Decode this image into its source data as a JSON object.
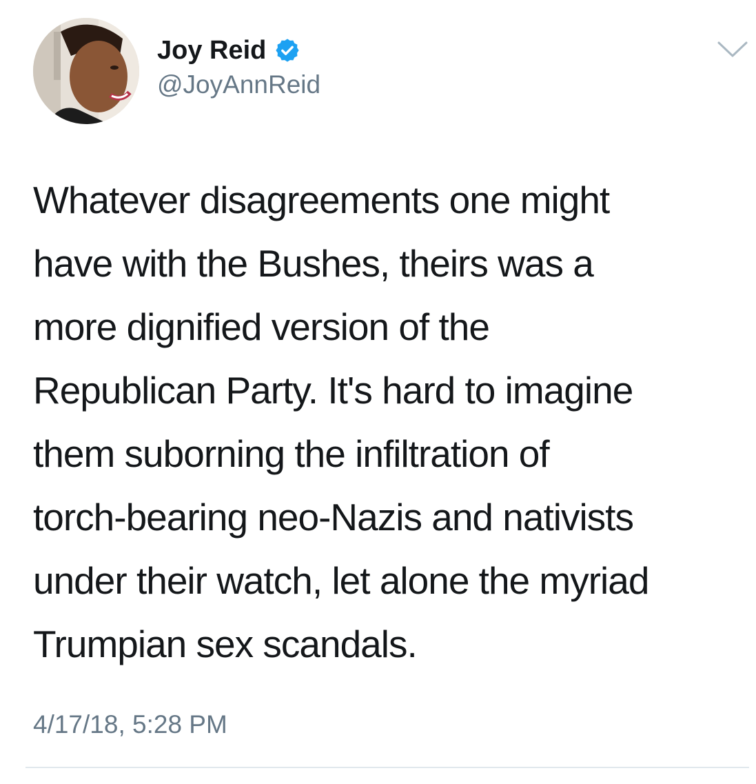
{
  "tweet": {
    "author": {
      "display_name": "Joy Reid",
      "handle": "@JoyAnnReid",
      "verified": true,
      "avatar_icon": "profile-photo"
    },
    "menu_icon": "chevron-down-icon",
    "text_lines": [
      "Whatever disagreements one might",
      "have with the Bushes, theirs was a",
      "more dignified version of the",
      "Republican Party. It's hard to imagine",
      "them suborning the infiltration of",
      "torch-bearing neo-Nazis and nativists",
      "under their watch, let alone the myriad",
      "Trumpian sex scandals."
    ],
    "timestamp": "4/17/18, 5:28 PM"
  },
  "colors": {
    "text": "#14171a",
    "secondary_text": "#657786",
    "verified_badge": "#1da1f2",
    "divider": "#e1e8ed",
    "chevron": "#aab8c2"
  }
}
